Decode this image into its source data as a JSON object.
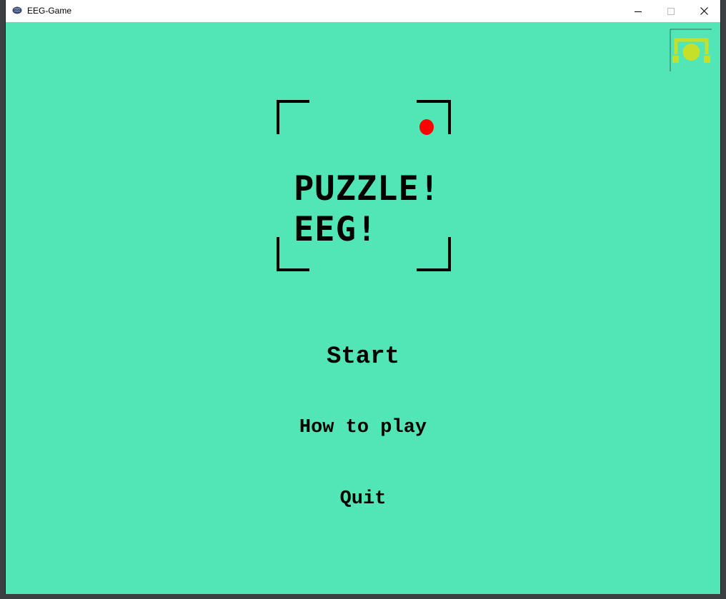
{
  "window": {
    "title": "EEG-Game",
    "icon": "brain-icon"
  },
  "titlebar_buttons": {
    "minimize_icon": "minimize-icon",
    "maximize_icon": "maximize-icon",
    "close_icon": "close-icon"
  },
  "game": {
    "background_color": "#52e5b5",
    "headset_icon": "headset-icon",
    "headset_color": "#c6e02a",
    "logo": {
      "line1": "PUZZLE!",
      "line2": "EEG!",
      "record_dot_color": "#ff0000"
    },
    "menu": {
      "start": "Start",
      "how_to_play": "How to play",
      "quit": "Quit"
    }
  }
}
